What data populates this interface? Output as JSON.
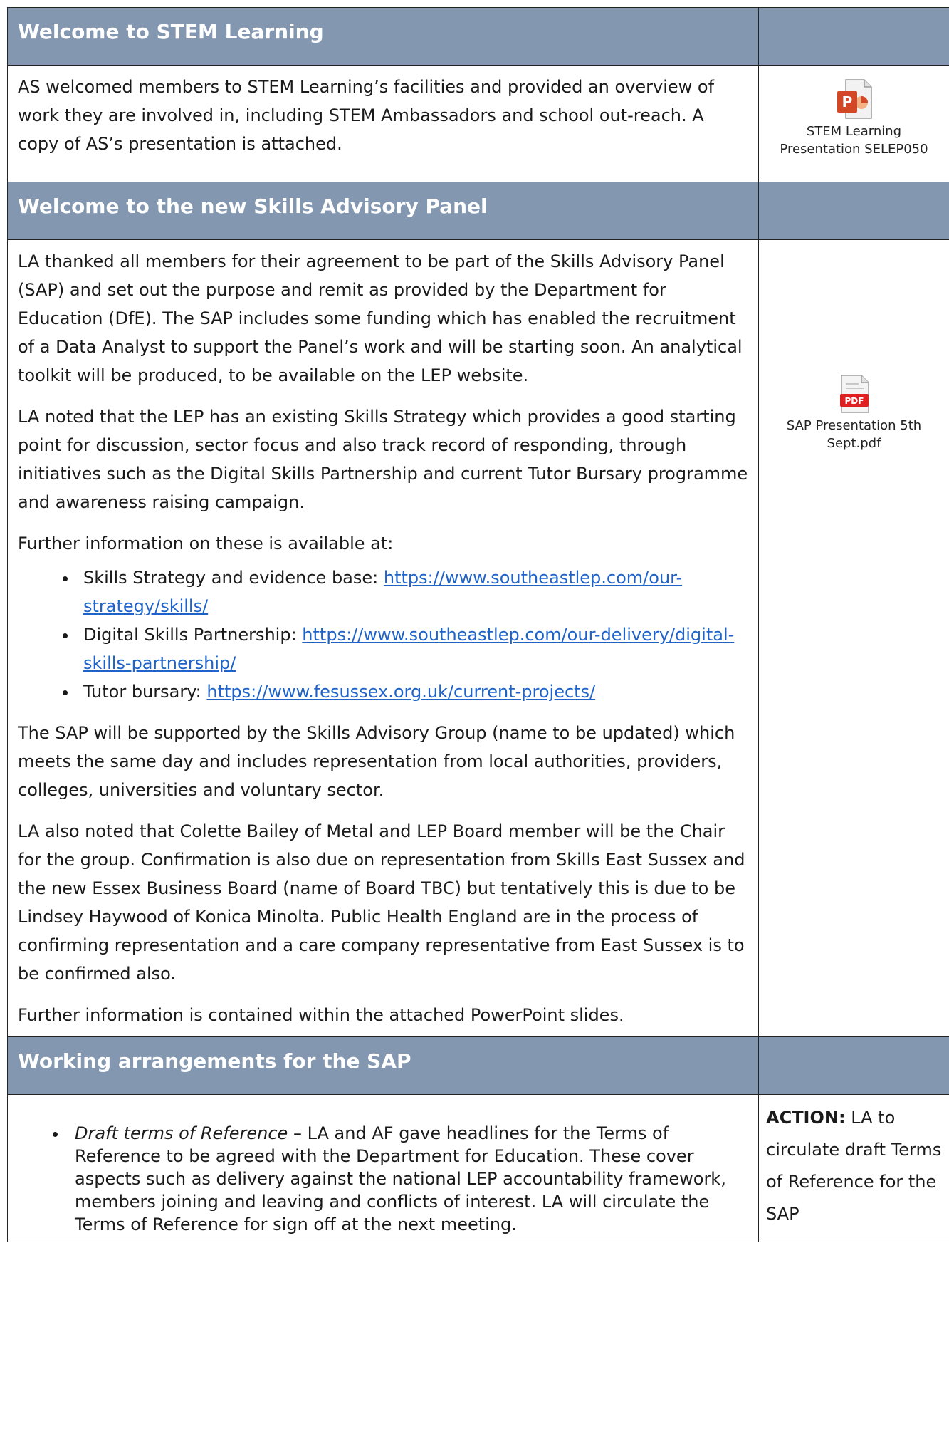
{
  "sections": {
    "stem": {
      "title": "Welcome to STEM Learning",
      "body": "AS welcomed members to STEM Learning’s facilities and provided an overview of work they are involved in, including STEM Ambassadors and school out-reach.  A copy of AS’s presentation is attached.",
      "attachment": {
        "icon": "powerpoint-file-icon",
        "label_line1": "STEM Learning",
        "label_line2": "Presentation SELEP050",
        "color": "#d24726"
      }
    },
    "sap": {
      "title": "Welcome to the new Skills Advisory Panel",
      "p1": "LA thanked all members for their agreement to be part of the Skills Advisory Panel (SAP) and set out the purpose and remit as provided by the Department for Education (DfE). The SAP includes some funding which has enabled the recruitment of a Data Analyst to support the Panel’s work and will be starting soon. An analytical toolkit will be produced, to be available on the LEP website.",
      "p2": "LA noted that the LEP has an existing Skills Strategy which provides a good starting point for discussion, sector focus and also track record of responding, through initiatives such as the Digital Skills Partnership and current Tutor Bursary programme and awareness raising campaign.",
      "p3": "Further information on these is available at:",
      "links": [
        {
          "label": "Skills Strategy and evidence base: ",
          "url": "https://www.southeastlep.com/our-strategy/skills/"
        },
        {
          "label": "Digital Skills Partnership: ",
          "url": "https://www.southeastlep.com/our-delivery/digital-skills-partnership/"
        },
        {
          "label": "Tutor bursary: ",
          "url": "https://www.fesussex.org.uk/current-projects/"
        }
      ],
      "p4": "The SAP will be supported by the Skills Advisory Group (name to be updated) which meets the same day and includes representation from local authorities, providers, colleges, universities and voluntary sector.",
      "p5": "LA also noted that Colette Bailey of Metal and LEP Board member will be the Chair for the group. Confirmation is also due on representation from Skills East Sussex and the new Essex Business Board (name of Board TBC) but tentatively this is due to be Lindsey Haywood of Konica Minolta. Public Health England are in the process of confirming representation and a care company representative from East Sussex is to be confirmed also.",
      "p6": "Further information is contained within the attached PowerPoint slides.",
      "attachment": {
        "icon": "pdf-file-icon",
        "badge": "PDF",
        "label_line1": "SAP Presentation 5th",
        "label_line2": "Sept.pdf",
        "color": "#e02020"
      }
    },
    "working": {
      "title": "Working arrangements for the SAP",
      "item_italic": "Draft terms of Reference",
      "item_text": " – LA and AF gave headlines for the Terms of Reference to be agreed with the Department for Education. These cover aspects such as delivery against the national LEP accountability framework, members joining and leaving and conflicts of interest. LA will circulate the Terms of Reference for sign off at the next meeting.",
      "action_label": "ACTION:",
      "action_text": " LA to circulate draft Terms of Reference for the SAP"
    }
  },
  "colors": {
    "header_bg": "#8497b0",
    "header_text": "#ffffff",
    "link": "#1f63c9"
  }
}
